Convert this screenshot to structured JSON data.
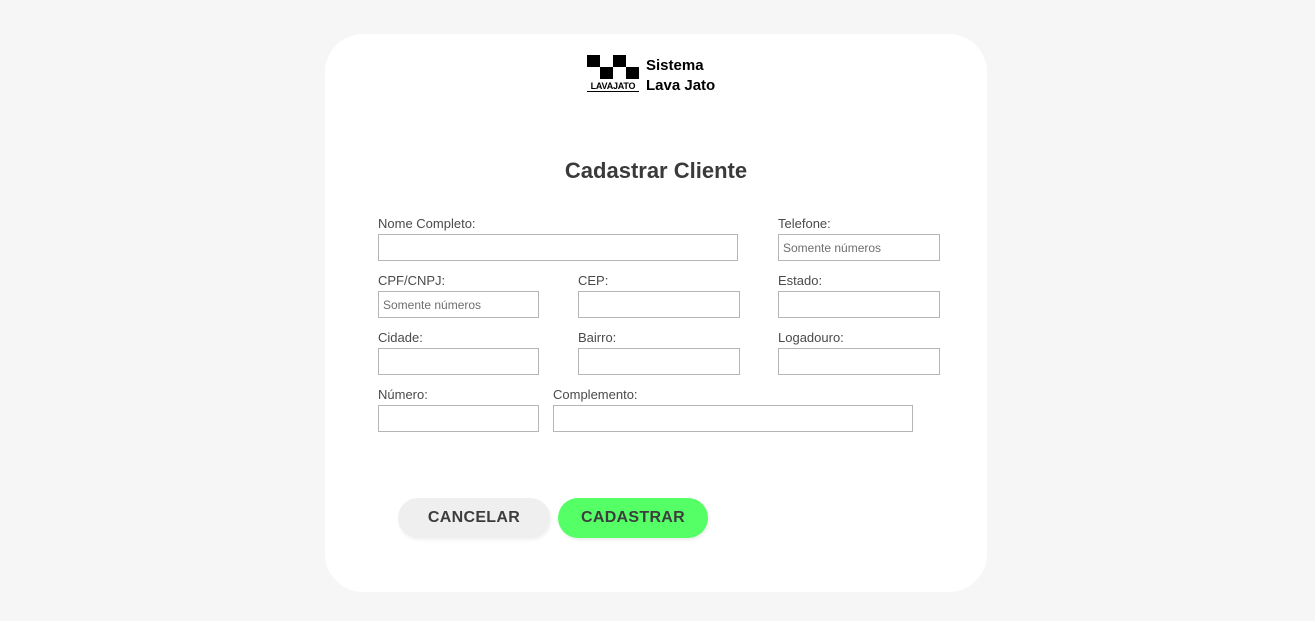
{
  "brand": {
    "logo_word": "LAVAJATO",
    "name_line1": "Sistema",
    "name_line2": "Lava Jato"
  },
  "form": {
    "title": "Cadastrar Cliente",
    "fields": {
      "nome": {
        "label": "Nome Completo:",
        "placeholder": "",
        "value": ""
      },
      "telefone": {
        "label": "Telefone:",
        "placeholder": "Somente números",
        "value": ""
      },
      "cpf": {
        "label": "CPF/CNPJ:",
        "placeholder": "Somente números",
        "value": ""
      },
      "cep": {
        "label": "CEP:",
        "placeholder": "",
        "value": ""
      },
      "estado": {
        "label": "Estado:",
        "placeholder": "",
        "value": ""
      },
      "cidade": {
        "label": "Cidade:",
        "placeholder": "",
        "value": ""
      },
      "bairro": {
        "label": "Bairro:",
        "placeholder": "",
        "value": ""
      },
      "logradouro": {
        "label": "Logadouro:",
        "placeholder": "",
        "value": ""
      },
      "numero": {
        "label": "Número:",
        "placeholder": "",
        "value": ""
      },
      "complemento": {
        "label": "Complemento:",
        "placeholder": "",
        "value": ""
      }
    },
    "buttons": {
      "cancel": "CANCELAR",
      "submit": "CADASTRAR"
    }
  },
  "colors": {
    "page_bg": "#f6f6f6",
    "card_bg": "#ffffff",
    "submit_bg": "#55ff66",
    "cancel_bg": "#efefef"
  }
}
